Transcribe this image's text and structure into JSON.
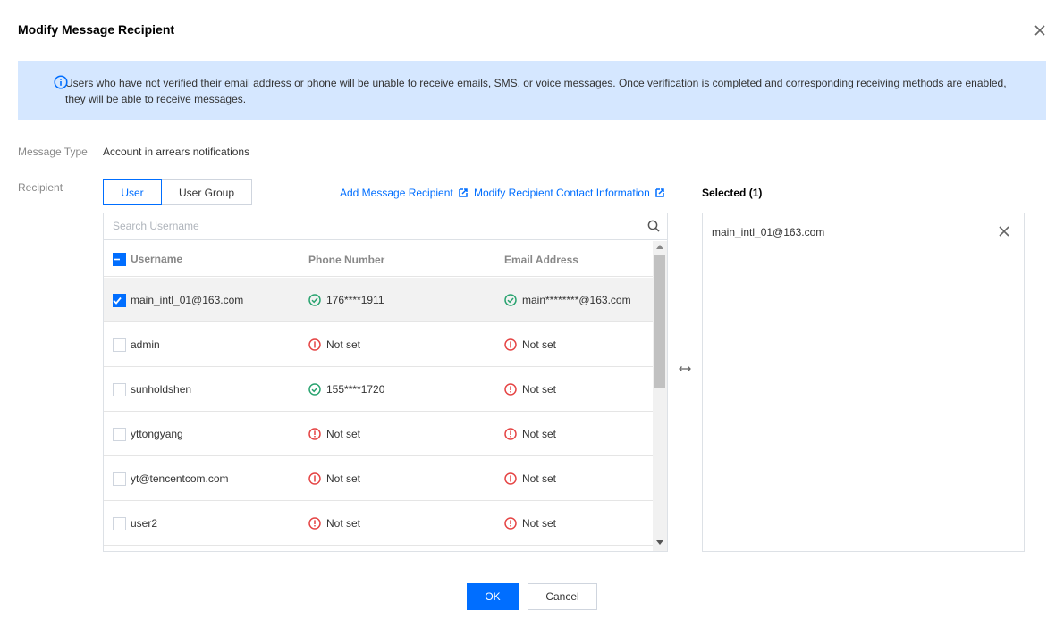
{
  "dialog": {
    "title": "Modify Message Recipient"
  },
  "notice": {
    "text": "Users who have not verified their email address or phone will be unable to receive emails, SMS, or voice messages. Once verification is completed and corresponding receiving methods are enabled, they will be able to receive messages."
  },
  "form": {
    "message_type_label": "Message Type",
    "message_type_value": "Account in arrears notifications",
    "recipient_label": "Recipient"
  },
  "tabs": [
    {
      "label": "User",
      "active": true
    },
    {
      "label": "User Group",
      "active": false
    }
  ],
  "links": {
    "add_recipient": "Add Message Recipient",
    "modify_contact": "Modify Recipient Contact Information"
  },
  "search": {
    "placeholder": "Search Username"
  },
  "table": {
    "headers": [
      "Username",
      "Phone Number",
      "Email Address"
    ],
    "rows": [
      {
        "username": "main_intl_01@163.com",
        "phone": "176****1911",
        "phone_status": "verified",
        "email": "main********@163.com",
        "email_status": "verified",
        "checked": true
      },
      {
        "username": "admin",
        "phone": "Not set",
        "phone_status": "not-set",
        "email": "Not set",
        "email_status": "not-set",
        "checked": false
      },
      {
        "username": "sunholdshen",
        "phone": "155****1720",
        "phone_status": "verified",
        "email": "Not set",
        "email_status": "not-set",
        "checked": false
      },
      {
        "username": "yttongyang",
        "phone": "Not set",
        "phone_status": "not-set",
        "email": "Not set",
        "email_status": "not-set",
        "checked": false
      },
      {
        "username": "yt@tencentcom.com",
        "phone": "Not set",
        "phone_status": "not-set",
        "email": "Not set",
        "email_status": "not-set",
        "checked": false
      },
      {
        "username": "user2",
        "phone": "Not set",
        "phone_status": "not-set",
        "email": "Not set",
        "email_status": "not-set",
        "checked": false
      }
    ]
  },
  "selected": {
    "title": "Selected (1)",
    "items": [
      "main_intl_01@163.com"
    ]
  },
  "buttons": {
    "ok": "OK",
    "cancel": "Cancel"
  },
  "colors": {
    "accent": "#006eff",
    "notice_bg": "#d5e7ff",
    "success": "#2ba471",
    "error": "#e54545"
  }
}
